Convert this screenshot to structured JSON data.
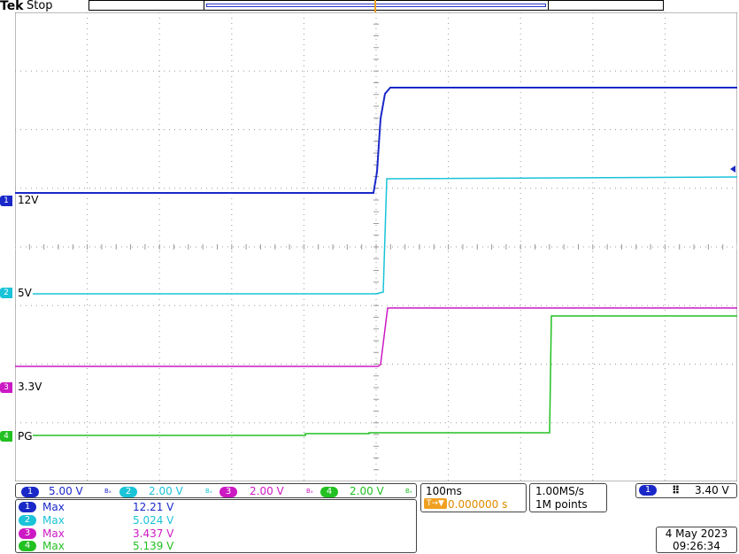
{
  "header": {
    "brand": "Tek",
    "state": "Stop",
    "trigger_marker": "T"
  },
  "colors": {
    "ch1": "#1a28c8",
    "ch2": "#19c3d8",
    "ch3": "#cc19c3",
    "ch4": "#22c022",
    "trigger": "#f0a020",
    "grid": "#9a9a9a"
  },
  "channels": [
    {
      "num": "1",
      "label": "12V"
    },
    {
      "num": "2",
      "label": "5V"
    },
    {
      "num": "3",
      "label": "3.3V"
    },
    {
      "num": "4",
      "label": "PG"
    }
  ],
  "vertical_scales": [
    {
      "num": "1",
      "value": "5.00 V"
    },
    {
      "num": "2",
      "value": "2.00 V"
    },
    {
      "num": "3",
      "value": "2.00 V"
    },
    {
      "num": "4",
      "value": "2.00 V"
    }
  ],
  "bw_label": "Bₓ",
  "timebase": {
    "scale": "100ms",
    "delay": "0.000000 s"
  },
  "acquisition": {
    "rate": "1.00MS/s",
    "points": "1M points"
  },
  "trigger": {
    "source": "1",
    "level": "3.40 V"
  },
  "measurements": [
    {
      "num": "1",
      "name": "Max",
      "value": "12.21 V"
    },
    {
      "num": "2",
      "name": "Max",
      "value": "5.024 V"
    },
    {
      "num": "3",
      "name": "Max",
      "value": "3.437 V"
    },
    {
      "num": "4",
      "name": "Max",
      "value": "5.139 V"
    }
  ],
  "datetime": {
    "date": "4 May 2023",
    "time": "09:26:34"
  }
}
